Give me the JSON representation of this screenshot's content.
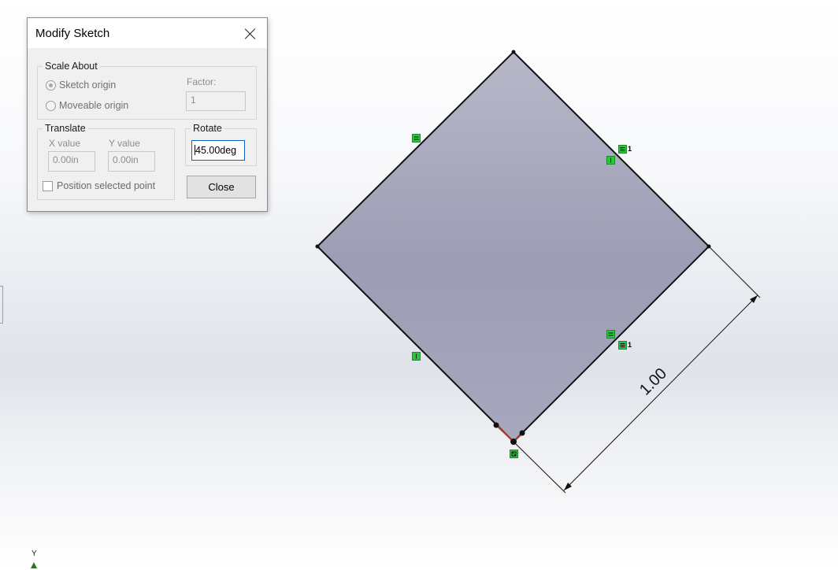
{
  "dialog": {
    "title": "Modify Sketch",
    "close_icon": "close-icon",
    "scale_about": {
      "legend": "Scale About",
      "options": [
        "Sketch origin",
        "Moveable origin"
      ],
      "selected": "Sketch origin",
      "factor_label": "Factor:",
      "factor_value": "1"
    },
    "translate": {
      "legend": "Translate",
      "x_label": "X value",
      "x_value": "0.00in",
      "y_label": "Y value",
      "y_value": "0.00in",
      "position_selected_point": "Position selected point"
    },
    "rotate": {
      "legend": "Rotate",
      "value": "45.00deg"
    },
    "close_button": "Close"
  },
  "sketch": {
    "dimension_value": "1.00",
    "relation_count_1": "1",
    "relation_count_2": "1",
    "axis_label": "Y",
    "colors": {
      "fill": "#a6a8bd",
      "edge": "#111111",
      "relation_marker": "#2fc43f",
      "origin_line": "#c0392b",
      "axis_arrow": "#1e7b1e"
    },
    "relation_icons": [
      "horizontal-icon",
      "vertical-icon",
      "equal-icon",
      "fix-icon"
    ]
  }
}
